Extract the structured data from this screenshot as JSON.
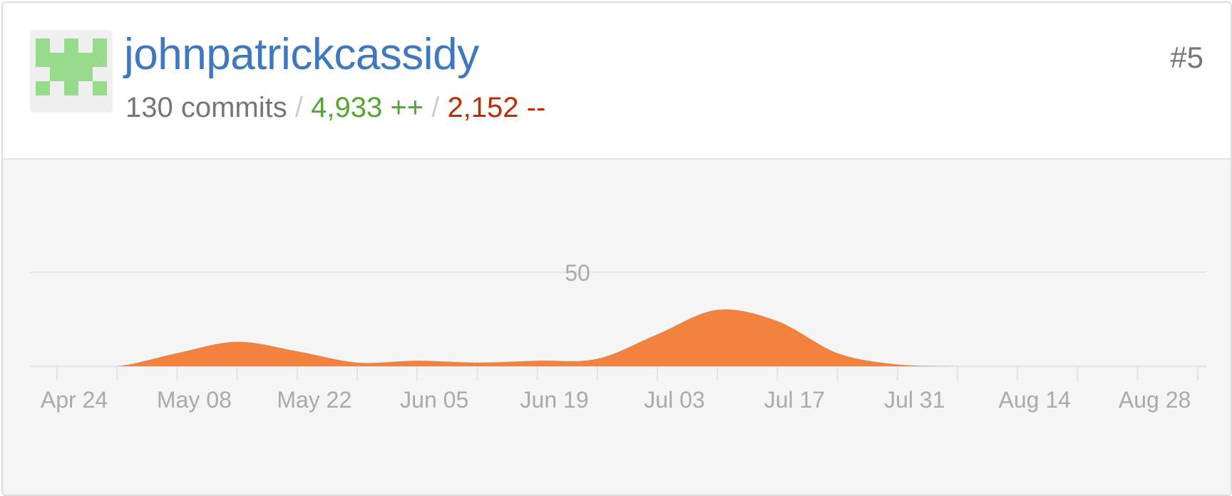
{
  "contributor": {
    "username": "johnpatrickcassidy",
    "commits": "130 commits",
    "separator": "/",
    "additions": "4,933 ++",
    "deletions": "2,152 --",
    "rank": "#5",
    "avatar": "identicon-avatar"
  },
  "colors": {
    "username": "#4078c0",
    "additions": "#55a532",
    "deletions": "#bd2c00",
    "area_fill": "#f4823f",
    "chart_bg": "#f5f5f5",
    "axis_label": "#aaaaaa",
    "identicon": "#99db8c"
  },
  "chart_data": {
    "type": "area",
    "title": "",
    "xlabel": "",
    "ylabel": "",
    "ylim": [
      0,
      50
    ],
    "yticks": [
      50
    ],
    "ytick_labels": [
      "50"
    ],
    "xtick_labels": [
      "Apr 24",
      "May 08",
      "May 22",
      "Jun 05",
      "Jun 19",
      "Jul 03",
      "Jul 17",
      "Jul 31",
      "Aug 14",
      "Aug 28"
    ],
    "grid": true,
    "series": [
      {
        "x": [
          "Apr 24",
          "May 01",
          "May 08",
          "May 15",
          "May 22",
          "May 29",
          "Jun 05",
          "Jun 12",
          "Jun 19",
          "Jun 26",
          "Jul 03",
          "Jul 10",
          "Jul 17",
          "Jul 24",
          "Jul 31",
          "Aug 07",
          "Aug 14",
          "Aug 21",
          "Aug 28",
          "Sep 04"
        ],
        "values": [
          0,
          0,
          7,
          13,
          8,
          2,
          3,
          2,
          3,
          4,
          17,
          30,
          24,
          7,
          1,
          0,
          0,
          0,
          0,
          0
        ]
      }
    ]
  }
}
